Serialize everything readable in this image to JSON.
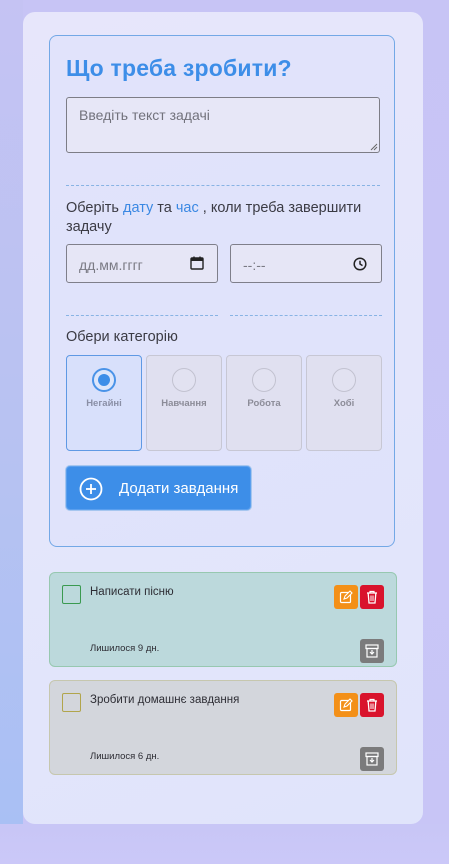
{
  "form": {
    "title": "Що треба зробити?",
    "task_placeholder": "Введіть текст задачі",
    "prompt_prefix": "Оберіть ",
    "prompt_date": "дату",
    "prompt_and": " та ",
    "prompt_time": "час",
    "prompt_suffix": " , коли треба завершити задачу",
    "date_placeholder": "дд.мм.гггг",
    "time_placeholder": "--:--",
    "category_label": "Обери категорію",
    "categories": [
      {
        "label": "Негайні",
        "selected": true
      },
      {
        "label": "Навчання",
        "selected": false
      },
      {
        "label": "Робота",
        "selected": false
      },
      {
        "label": "Хобі",
        "selected": false
      }
    ],
    "add_button": "Додати завдання"
  },
  "todos": [
    {
      "text": "Написати пісню",
      "remaining": "Лишилося 9 дн.",
      "color": "#bcd9dc"
    },
    {
      "text": "Зробити домашнє завдання",
      "remaining": "Лишилося 6 дн.",
      "color": "#d3d6dc"
    }
  ],
  "icons": {
    "calendar": "calendar-icon",
    "clock": "clock-icon",
    "plus": "plus-circle-icon",
    "edit": "edit-icon",
    "delete": "trash-icon",
    "archive": "archive-icon"
  },
  "colors": {
    "accent": "#3d8ee8",
    "edit": "#f39018",
    "delete": "#d9132c",
    "archive": "#7b7b7c"
  }
}
